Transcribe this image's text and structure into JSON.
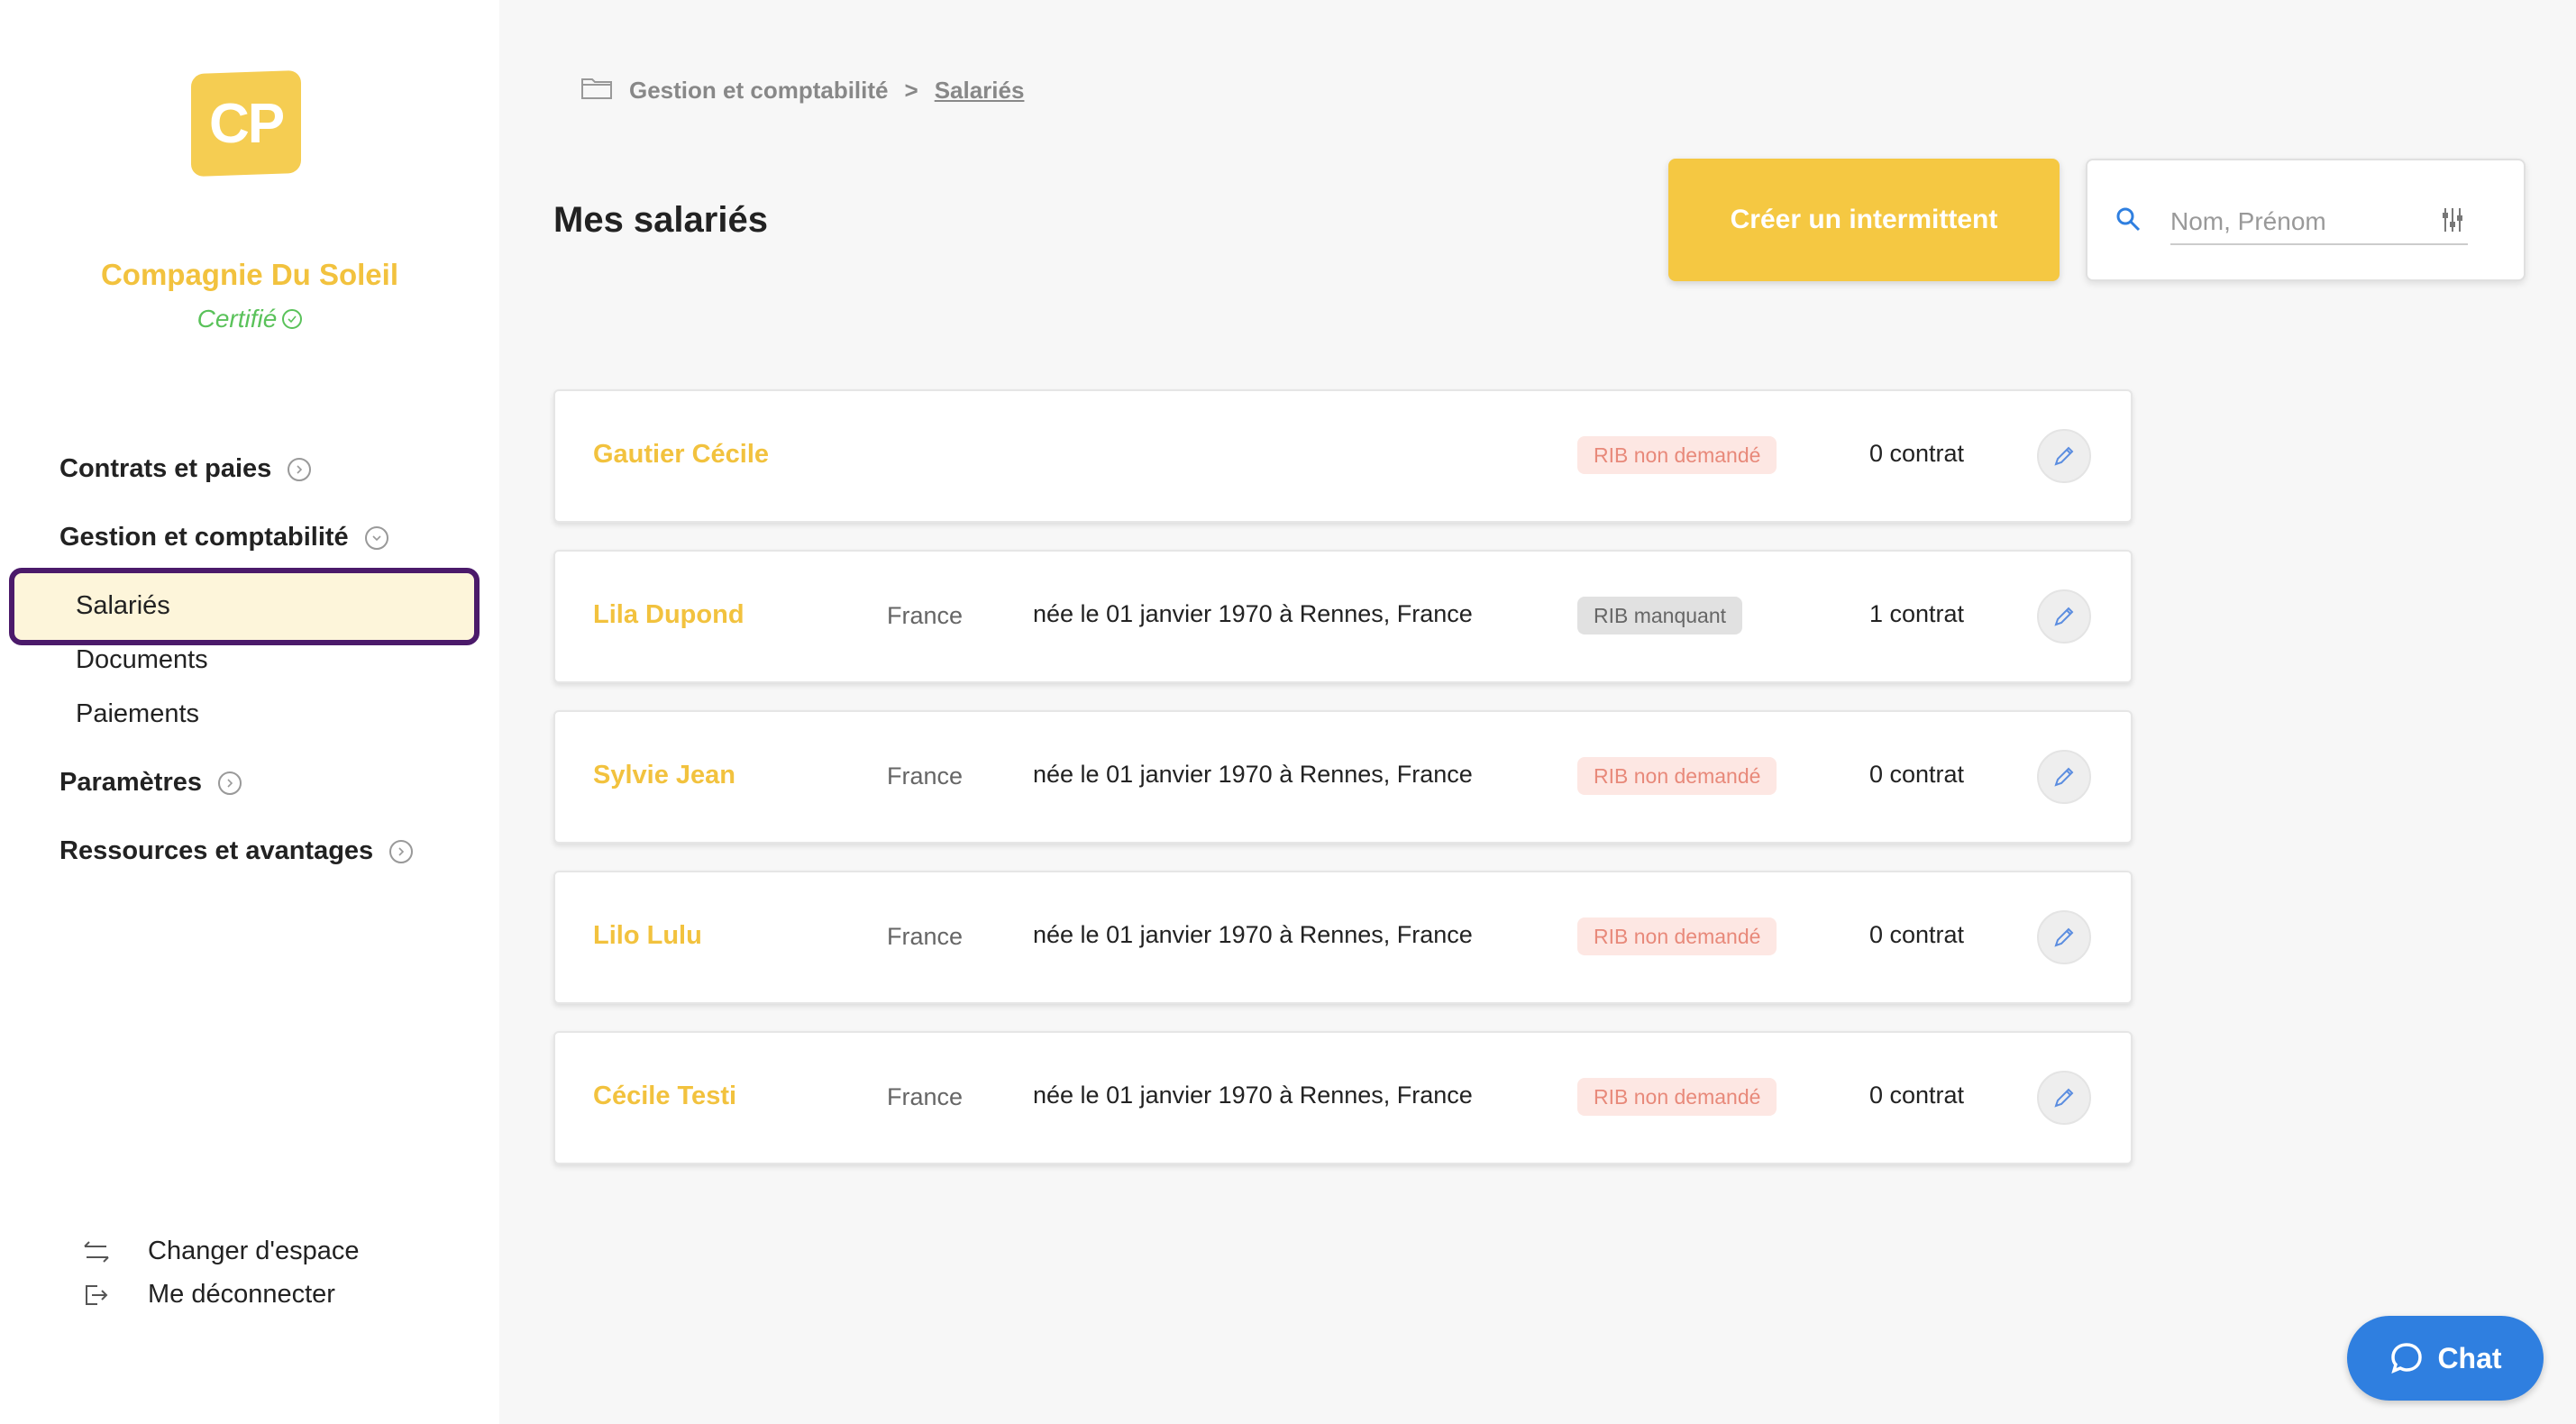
{
  "sidebar": {
    "logo_text": "CP",
    "company_name": "Compagnie Du Soleil",
    "certified_label": "Certifié",
    "nav": {
      "contrats": "Contrats et paies",
      "gestion": "Gestion et comptabilité",
      "gestion_items": [
        "Salariés",
        "Documents",
        "Paiements"
      ],
      "parametres": "Paramètres",
      "ressources": "Ressources et avantages"
    },
    "footer": {
      "switch_space": "Changer d'espace",
      "logout": "Me déconnecter"
    }
  },
  "breadcrumb": {
    "parent": "Gestion et comptabilité",
    "separator": ">",
    "current": "Salariés"
  },
  "page_title": "Mes salariés",
  "create_button": "Créer un intermittent",
  "search": {
    "placeholder": "Nom, Prénom",
    "value": ""
  },
  "employees": [
    {
      "name": "Gautier Cécile",
      "country": "",
      "birth": "",
      "rib": "RIB non demandé",
      "rib_status": "pink",
      "contracts": "0 contrat"
    },
    {
      "name": "Lila Dupond",
      "country": "France",
      "birth": "née le 01 janvier 1970 à Rennes, France",
      "rib": "RIB manquant",
      "rib_status": "gray",
      "contracts": "1 contrat"
    },
    {
      "name": "Sylvie Jean",
      "country": "France",
      "birth": "née le 01 janvier 1970 à Rennes, France",
      "rib": "RIB non demandé",
      "rib_status": "pink",
      "contracts": "0 contrat"
    },
    {
      "name": "Lilo Lulu",
      "country": "France",
      "birth": "née le 01 janvier 1970 à Rennes, France",
      "rib": "RIB non demandé",
      "rib_status": "pink",
      "contracts": "0 contrat"
    },
    {
      "name": "Cécile Testi",
      "country": "France",
      "birth": "née le 01 janvier 1970 à Rennes, France",
      "rib": "RIB non demandé",
      "rib_status": "pink",
      "contracts": "0 contrat"
    }
  ],
  "chat_label": "Chat",
  "colors": {
    "accent": "#f5c842",
    "active_outline": "#4b1a6a",
    "certified": "#5ac25a",
    "chat": "#2f7fe0"
  }
}
